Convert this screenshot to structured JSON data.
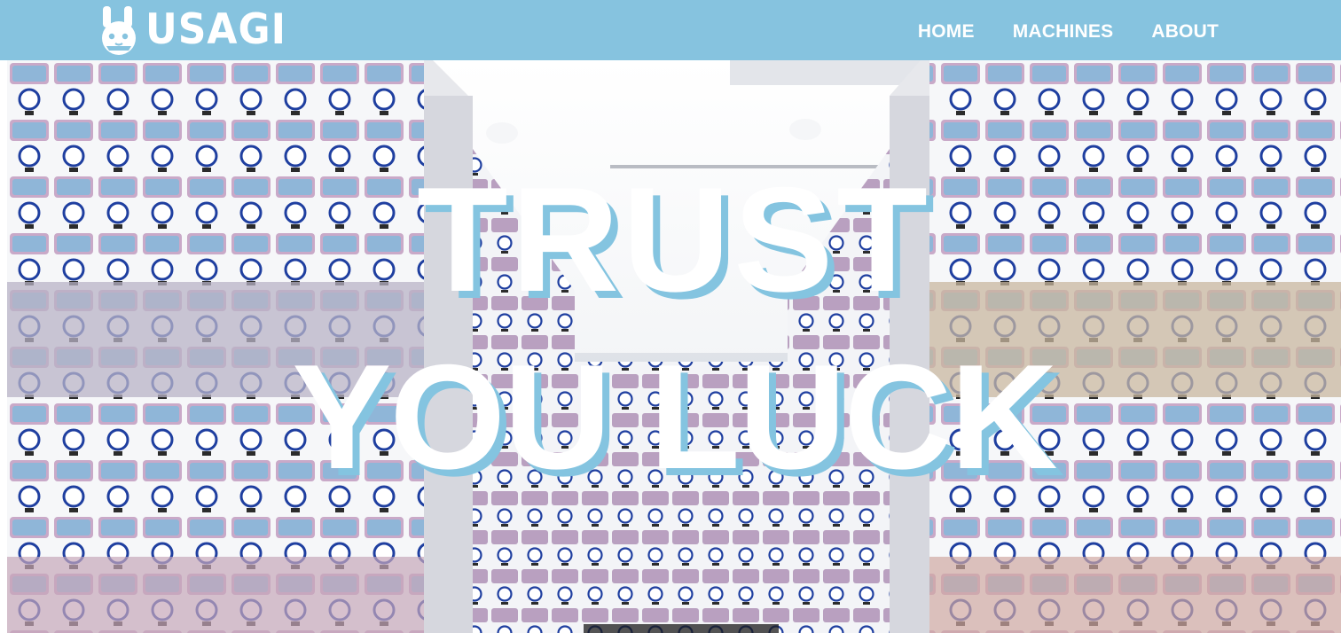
{
  "header": {
    "brand": {
      "logo_icon": "bunny-face-icon",
      "name": "USAGI"
    },
    "nav": [
      {
        "label": "HOME"
      },
      {
        "label": "MACHINES"
      },
      {
        "label": "ABOUT"
      }
    ]
  },
  "hero": {
    "background": "gachapon-machine-aisle-photo",
    "headline_line1": "TRUST",
    "headline_line2": "YOU LUCK"
  },
  "colors": {
    "header_bg": "#86c3df",
    "text": "#ffffff",
    "headline_shadow": "#84c4e0"
  }
}
